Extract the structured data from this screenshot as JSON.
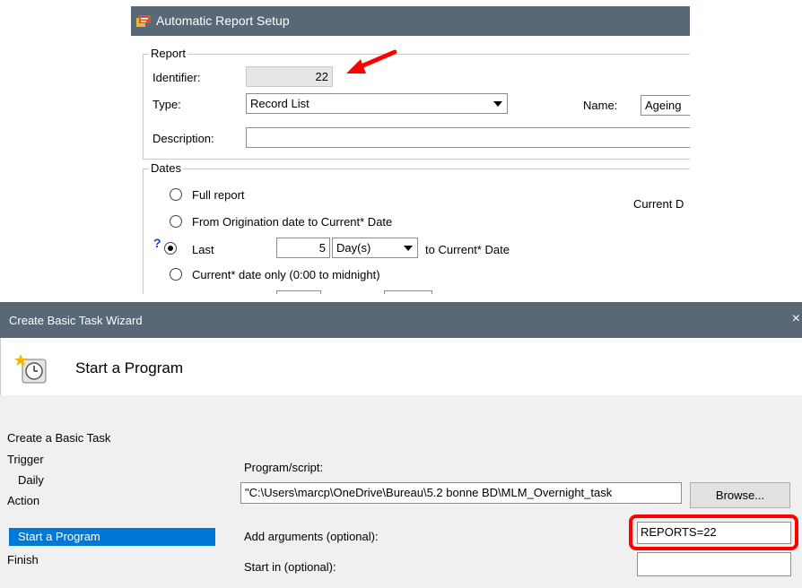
{
  "report_window": {
    "title": "Automatic Report Setup",
    "report_group": {
      "title": "Report",
      "identifier_label": "Identifier:",
      "identifier_value": "22",
      "type_label": "Type:",
      "type_value": "Record List",
      "name_label": "Name:",
      "name_value": "Ageing",
      "description_label": "Description:",
      "description_value": ""
    },
    "dates_group": {
      "title": "Dates",
      "options": [
        {
          "label": "Full report",
          "checked": false
        },
        {
          "label": "From Origination date to Current* Date",
          "checked": false
        },
        {
          "label": "Last",
          "checked": true
        },
        {
          "label": "Current* date only (0:00 to midnight)",
          "checked": false
        }
      ],
      "last_amount": "5",
      "last_unit": "Day(s)",
      "last_suffix": "to Current* Date",
      "current_label": "Current D",
      "help_mark": "?"
    }
  },
  "wizard_window": {
    "title": "Create Basic Task Wizard",
    "close_glyph": "×",
    "header_title": "Start a Program",
    "nav": [
      {
        "label": "Create a Basic Task",
        "indent": false,
        "selected": false
      },
      {
        "label": "Trigger",
        "indent": false,
        "selected": false
      },
      {
        "label": "Daily",
        "indent": true,
        "selected": false
      },
      {
        "label": "Action",
        "indent": false,
        "selected": false
      },
      {
        "label": "Start a Program",
        "indent": true,
        "selected": true
      },
      {
        "label": "Finish",
        "indent": false,
        "selected": false
      }
    ],
    "program_label": "Program/script:",
    "program_value": "\"C:\\Users\\marcp\\OneDrive\\Bureau\\5.2 bonne BD\\MLM_Overnight_task",
    "browse_label": "Browse...",
    "arguments_label": "Add arguments (optional):",
    "arguments_value": "REPORTS=22",
    "start_in_label": "Start in (optional):",
    "start_in_value": ""
  },
  "colors": {
    "titlebar": "#5a6775",
    "selection": "#0078d7",
    "annotation": "#ff0000"
  }
}
